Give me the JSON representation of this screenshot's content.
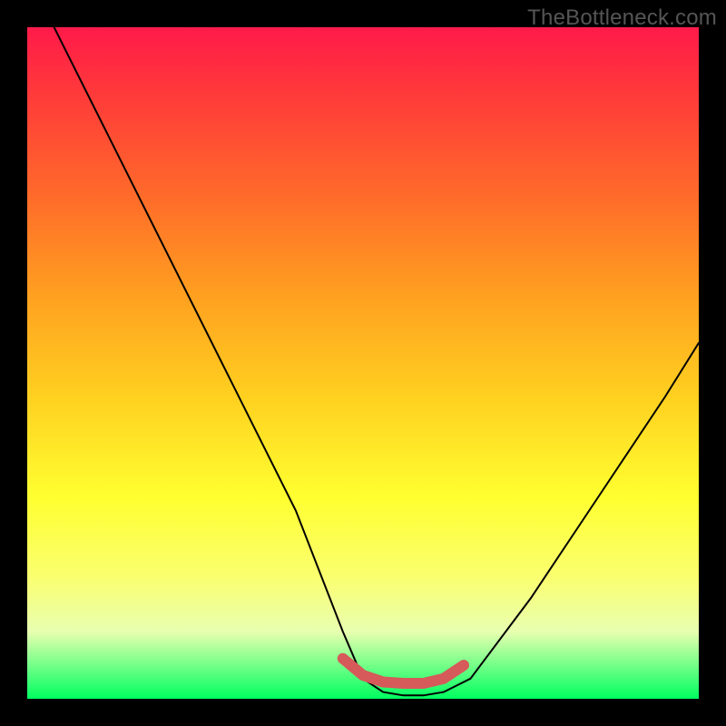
{
  "watermark": "TheBottleneck.com",
  "chart_data": {
    "type": "line",
    "title": "",
    "xlabel": "",
    "ylabel": "",
    "xlim": [
      0,
      100
    ],
    "ylim": [
      0,
      100
    ],
    "series": [
      {
        "name": "black-curve",
        "x": [
          4,
          10,
          20,
          30,
          40,
          47,
          50,
          53,
          56,
          59,
          62,
          66,
          75,
          85,
          95,
          100
        ],
        "values": [
          100,
          88,
          68,
          48,
          28,
          10,
          3,
          1,
          0.5,
          0.5,
          1,
          3,
          15,
          30,
          45,
          53
        ]
      },
      {
        "name": "red-flat-bottom",
        "x": [
          47,
          50,
          53,
          56,
          59,
          62,
          65
        ],
        "values": [
          6,
          3.5,
          2.5,
          2.3,
          2.3,
          3,
          5
        ]
      }
    ],
    "gradient_stops": [
      {
        "pos": 0,
        "color": "#ff1a4a"
      },
      {
        "pos": 10,
        "color": "#ff3a3a"
      },
      {
        "pos": 25,
        "color": "#ff6a2a"
      },
      {
        "pos": 40,
        "color": "#ffa020"
      },
      {
        "pos": 55,
        "color": "#ffd020"
      },
      {
        "pos": 70,
        "color": "#ffff30"
      },
      {
        "pos": 82,
        "color": "#faff70"
      },
      {
        "pos": 90,
        "color": "#e8ffb0"
      },
      {
        "pos": 100,
        "color": "#00ff60"
      }
    ]
  }
}
